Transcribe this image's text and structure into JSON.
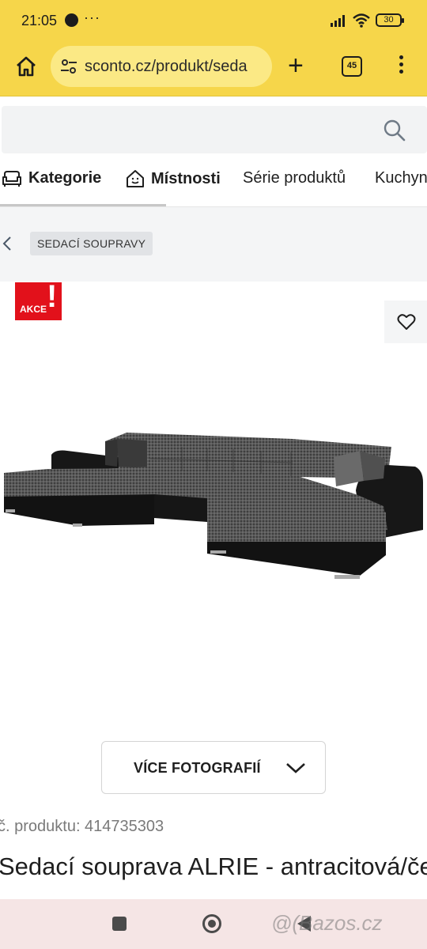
{
  "status_bar": {
    "time": "21:05",
    "battery": "30",
    "more": "···"
  },
  "browser": {
    "url": "sconto.cz/produkt/seda",
    "tab_count": "45"
  },
  "category_nav": {
    "items": [
      {
        "label": "Kategorie",
        "icon": "armchair-icon"
      },
      {
        "label": "Místnosti",
        "icon": "house-smile-icon"
      },
      {
        "label": "Série produktů"
      },
      {
        "label": "Kuchyně"
      }
    ]
  },
  "breadcrumb": {
    "tag": "SEDACÍ SOUPRAVY"
  },
  "product": {
    "badge": "AKCE",
    "badge_mark": "!",
    "more_photos": "VÍCE FOTOGRAFIÍ",
    "code": "č. produktu: 414735303",
    "title": "Sedací souprava ALRIE - antracitová/černá"
  },
  "watermark": "@(Bazos.cz",
  "colors": {
    "browser_chrome": "#f6d64a",
    "badge": "#e2111b",
    "nav_bar": "#f5e5e5"
  }
}
